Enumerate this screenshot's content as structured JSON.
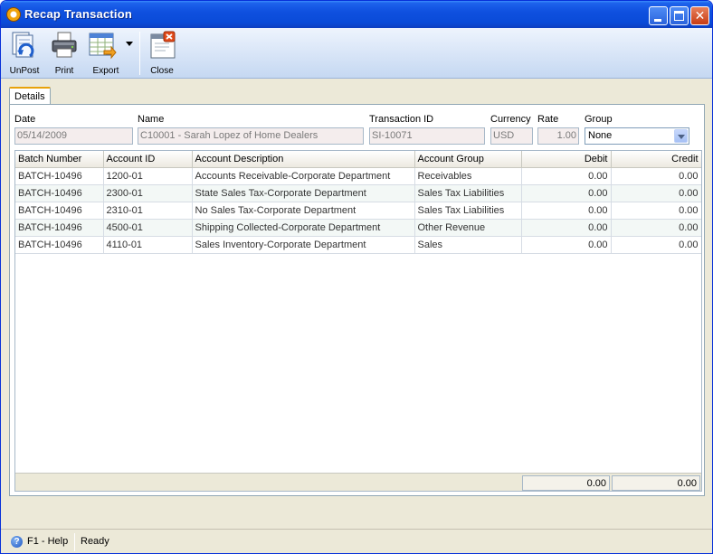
{
  "window": {
    "title": "Recap Transaction"
  },
  "toolbar": {
    "unpost_label": "UnPost",
    "print_label": "Print",
    "export_label": "Export",
    "close_label": "Close"
  },
  "tabs": [
    {
      "label": "Details"
    }
  ],
  "form": {
    "date_label": "Date",
    "date_value": "05/14/2009",
    "name_label": "Name",
    "name_value": "C10001 - Sarah Lopez of Home Dealers",
    "transaction_id_label": "Transaction ID",
    "transaction_id_value": "SI-10071",
    "currency_label": "Currency",
    "currency_value": "USD",
    "rate_label": "Rate",
    "rate_value": "1.00",
    "group_label": "Group",
    "group_value": "None"
  },
  "grid": {
    "columns": [
      "Batch Number",
      "Account ID",
      "Account Description",
      "Account Group",
      "Debit",
      "Credit"
    ],
    "rows": [
      [
        "BATCH-10496",
        "1200-01",
        "Accounts Receivable-Corporate Department",
        "Receivables",
        "0.00",
        "0.00"
      ],
      [
        "BATCH-10496",
        "2300-01",
        "State Sales Tax-Corporate Department",
        "Sales Tax Liabilities",
        "0.00",
        "0.00"
      ],
      [
        "BATCH-10496",
        "2310-01",
        "No Sales Tax-Corporate Department",
        "Sales Tax Liabilities",
        "0.00",
        "0.00"
      ],
      [
        "BATCH-10496",
        "4500-01",
        "Shipping Collected-Corporate Department",
        "Other Revenue",
        "0.00",
        "0.00"
      ],
      [
        "BATCH-10496",
        "4110-01",
        "Sales Inventory-Corporate Department",
        "Sales",
        "0.00",
        "0.00"
      ]
    ],
    "total_debit": "0.00",
    "total_credit": "0.00"
  },
  "status": {
    "help_label": "F1 - Help",
    "state": "Ready"
  },
  "colors": {
    "title_bar": "#0a4bd8",
    "accent_tab": "#e8a20b",
    "window_bg": "#ece9d8"
  }
}
